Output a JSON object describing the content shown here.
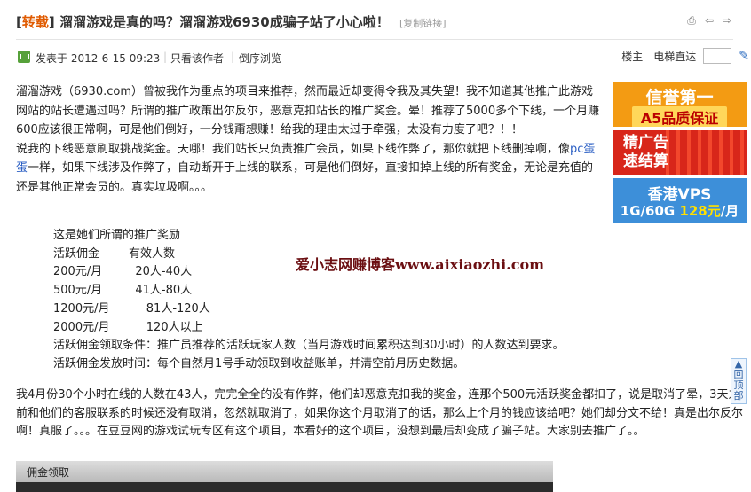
{
  "header": {
    "tag_open": "[",
    "tag_label": "转载",
    "tag_close": "]",
    "title": "溜溜游戏是真的吗？溜溜游戏6930成骗子站了小心啦！",
    "copy_link": "[复制链接]"
  },
  "meta": {
    "posted": "发表于 2012-6-15 09:23",
    "sep1": "|",
    "only_author": "只看该作者",
    "sep2": "|",
    "reverse": "倒序浏览",
    "floor_owner": "楼主",
    "elevator": "电梯直达"
  },
  "content": {
    "para1": "溜溜游戏（6930.com）曾被我作为重点的项目来推荐，然而最近却变得令我及其失望！我不知道其他推广此游戏网站的站长遭遇过吗？所谓的推广政策出尔反尔，恶意克扣站长的推广奖金。晕！推荐了5000多个下线，一个月赚600应该很正常啊，可是他们倒好，一分钱甭想赚！给我的理由太过于牵强，太没有力度了吧？！！",
    "para2_pre": "说我的下线恶意刷取挑战奖金。天哪！我们站长只负责推广会员，如果下线作弊了，那你就把下线删掉啊，像",
    "para2_link": "pc蛋蛋",
    "para2_post": "一样，如果下线涉及作弊了，自动断开于上线的联系，可是他们倒好，直接扣掉上线的所有奖金，无论是充值的还是其他正常会员的。真实垃圾啊。。。"
  },
  "incentive": {
    "title": "这是她们所谓的推广奖励",
    "header": "活跃佣金        有效人数",
    "rows": [
      "200元/月         20人-40人",
      "500元/月         41人-80人",
      "1200元/月          81人-120人",
      "2000元/月          120人以上"
    ],
    "condition": "活跃佣金领取条件：推广员推荐的活跃玩家人数（当月游戏时间累积达到30小时）的人数达到要求。",
    "payout": "活跃佣金发放时间：每个自然月1号手动领取到收益账单，并清空前月历史数据。"
  },
  "watermark": "爱小志网赚博客www.aixiaozhi.com",
  "para3": "我4月份30个小时在线的人数在43人，完完全全的没有作弊，他们却恶意克扣我的奖金，连那个500元活跃奖金都扣了，说是取消了晕，3天之前和他们的客服联系的时候还没有取消，忽然就取消了，如果你这个月取消了的话，那么上个月的钱应该给吧？她们却分文不给！真是出尔反尔啊！真服了。。。在豆豆网的游戏试玩专区有这个项目，本看好的这个项目，没想到最后却变成了骗子站。大家别去推广了。。",
  "ads": {
    "ad1_line1": "信誉第一",
    "ad1_line2": "A5品质保证",
    "ad2_line1": "精广告",
    "ad2_line2": "速结算",
    "ad3_line1": "香港VPS",
    "ad3_line2a": "1G/60G ",
    "ad3_line2b": "128元",
    "ad3_line2c": "/月"
  },
  "back_top": "回顶部",
  "screenshot_label": "佣金领取",
  "colors": {
    "tag": "#e05a00",
    "link": "#2b5fc4",
    "watermark": "#6b0f12"
  }
}
